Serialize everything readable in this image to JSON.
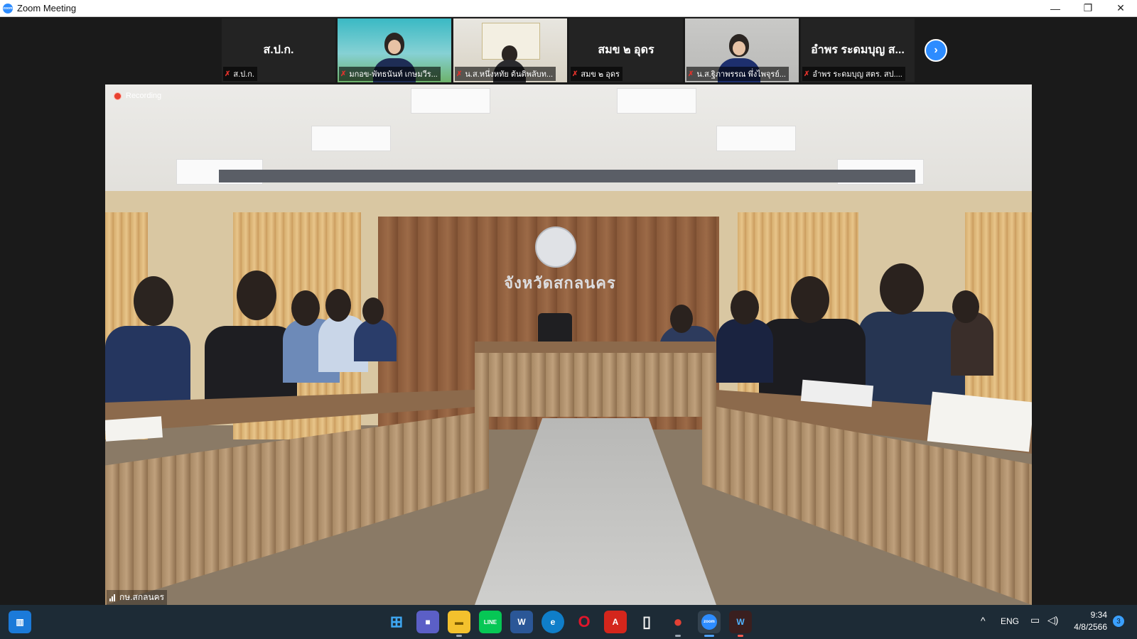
{
  "window": {
    "title": "Zoom Meeting",
    "app_icon_text": "zoom",
    "minimize_glyph": "—",
    "restore_glyph": "❐",
    "close_glyph": "✕"
  },
  "participants": [
    {
      "display_name": "ส.ป.ก.",
      "label": "ส.ป.ก.",
      "video": false,
      "muted": true
    },
    {
      "display_name": "",
      "label": "มกอข-พัทธนันท์ เกษมวีร...",
      "video": true,
      "muted": true
    },
    {
      "display_name": "",
      "label": "น.ส.หนึ่งหทัย ต้นติพลับท...",
      "video": true,
      "muted": true
    },
    {
      "display_name": "สมข ๒ อุดร",
      "label": "สมข ๒ อุดร",
      "video": false,
      "muted": true
    },
    {
      "display_name": "",
      "label": "น.ส.ฐิภาพรรณ พึ่งไพจุรย์...",
      "video": true,
      "muted": true
    },
    {
      "display_name": "อำพร ระดมบุญ ส...",
      "label": "อำพร ระดมบุญ สตร. สป....",
      "video": false,
      "muted": true
    }
  ],
  "next_page_icon": "chevron-right-icon",
  "main_video": {
    "recording_label": "Recording",
    "participant_label": "กษ.สกลนคร",
    "room_sign_text": "จังหวัดสกลนคร"
  },
  "taskbar": {
    "apps": [
      {
        "name": "windows-start",
        "glyph": "⊞"
      },
      {
        "name": "search",
        "glyph": "▦"
      },
      {
        "name": "teams-chat",
        "glyph": "■"
      },
      {
        "name": "file-explorer",
        "glyph": "▬"
      },
      {
        "name": "line",
        "glyph": "LINE"
      },
      {
        "name": "word",
        "glyph": "W"
      },
      {
        "name": "edge",
        "glyph": "e"
      },
      {
        "name": "opera",
        "glyph": "O"
      },
      {
        "name": "acrobat",
        "glyph": "A"
      },
      {
        "name": "notepad",
        "glyph": "▯"
      },
      {
        "name": "chrome",
        "glyph": "●"
      },
      {
        "name": "zoom",
        "glyph": "zoom"
      },
      {
        "name": "waves",
        "glyph": "W"
      }
    ],
    "tray": {
      "chevron": "^",
      "language": "ENG",
      "time": "9:34",
      "date": "4/8/2566",
      "notifications": "3"
    }
  },
  "colors": {
    "zoom_blue": "#2d8cff",
    "muted_red": "#e0322b",
    "recording_red": "#e8412f",
    "taskbar_bg": "#1d2b36"
  }
}
